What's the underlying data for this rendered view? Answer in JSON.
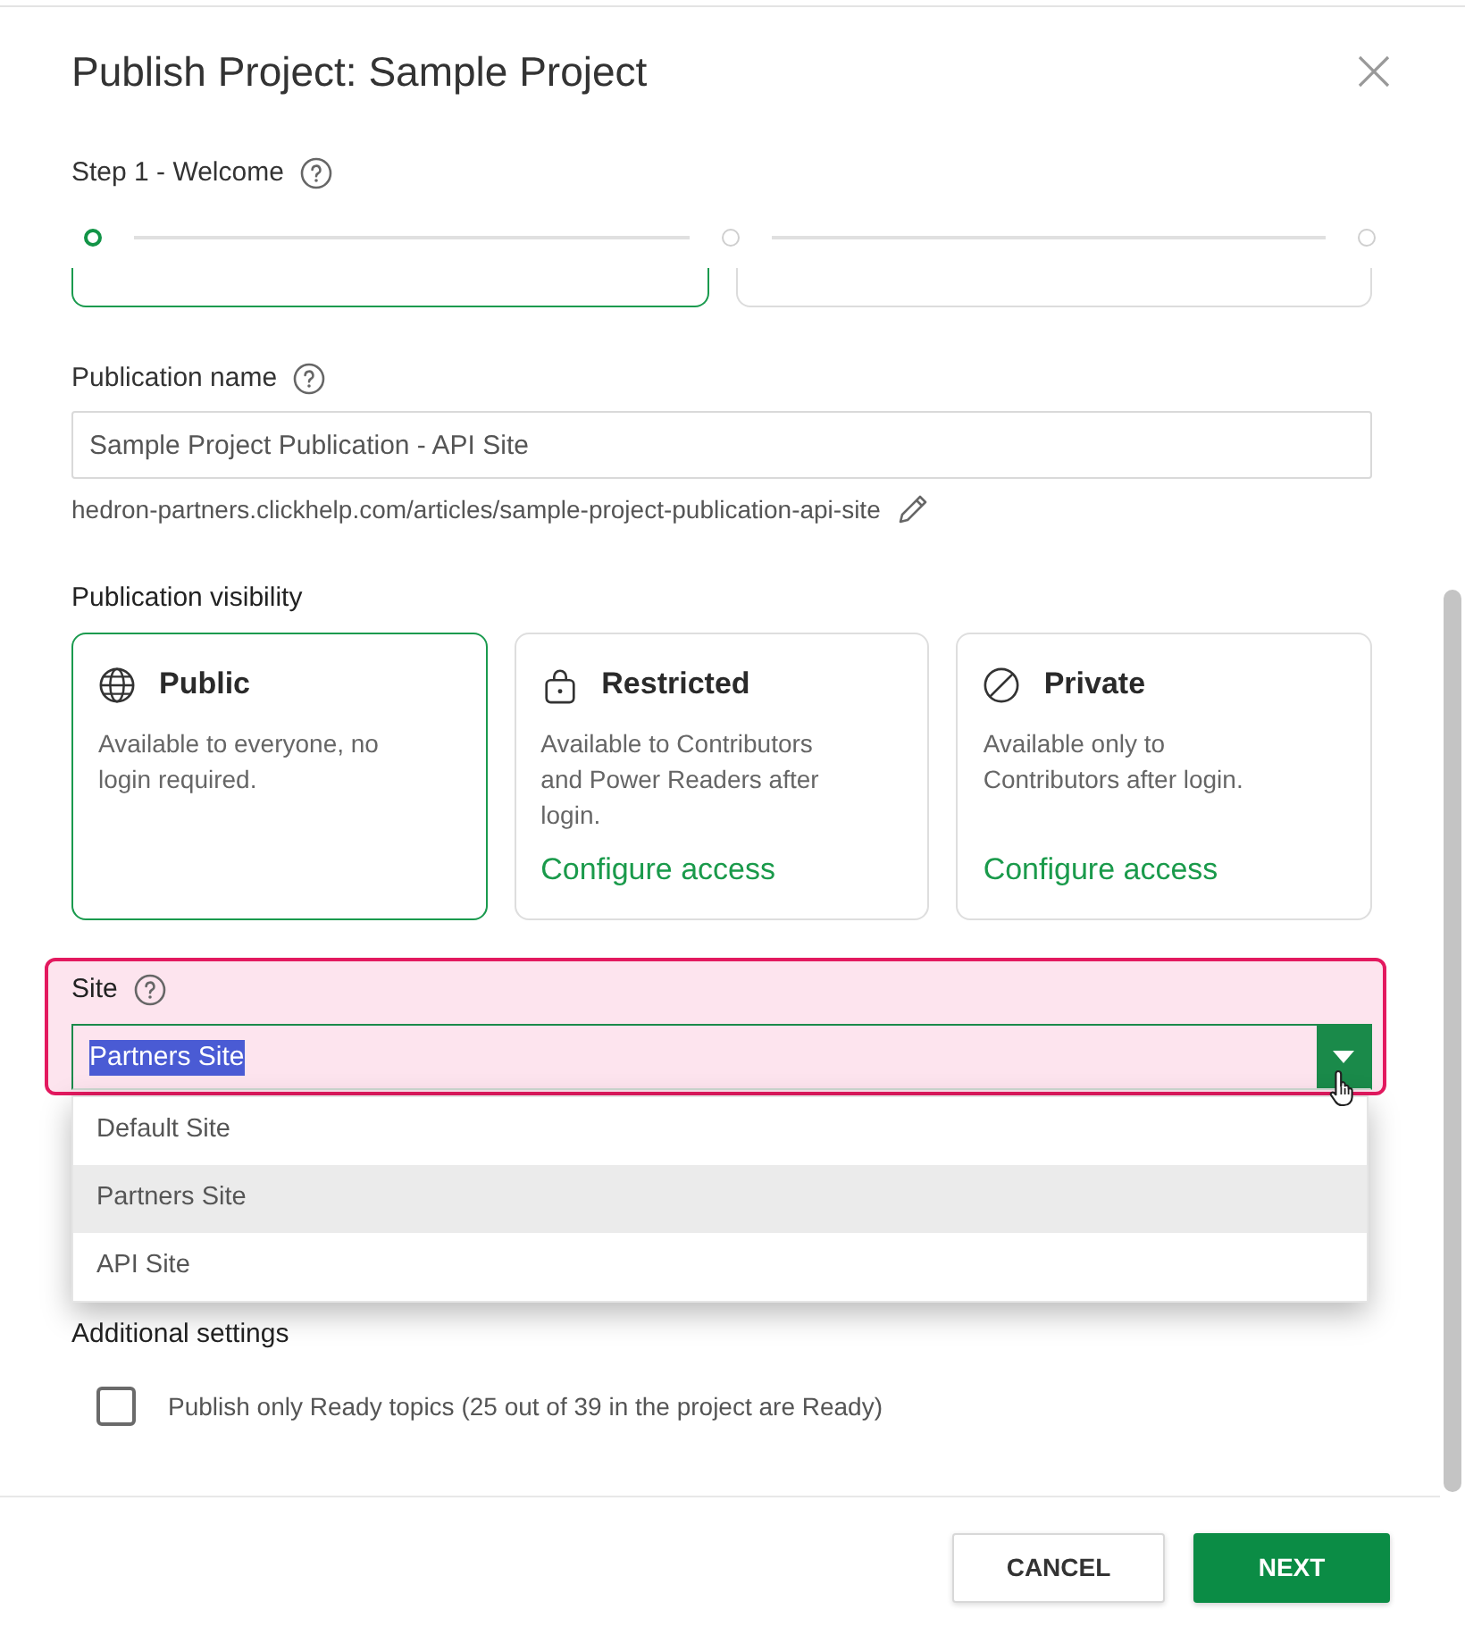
{
  "dialog": {
    "title": "Publish Project: Sample Project"
  },
  "step": {
    "label": "Step 1 - Welcome"
  },
  "stepper": [
    {
      "selected": true
    },
    {
      "selected": false
    },
    {
      "selected": false
    }
  ],
  "step_panels": [
    {
      "selected": true
    },
    {
      "selected": false
    }
  ],
  "publication_name": {
    "label": "Publication name",
    "value": "Sample Project Publication - API Site",
    "url": "hedron-partners.clickhelp.com/articles/sample-project-publication-api-site"
  },
  "visibility": {
    "label": "Publication visibility",
    "options": [
      {
        "kind": "globe",
        "title": "Public",
        "description": "Available to everyone, no login required.",
        "selected": true
      },
      {
        "kind": "lock",
        "title": "Restricted",
        "description": "Available to Contributors and Power Readers after login.",
        "link": "Configure access",
        "selected": false
      },
      {
        "kind": "ban",
        "title": "Private",
        "description": "Available only to Contributors after login.",
        "link": "Configure access",
        "selected": false
      }
    ]
  },
  "site": {
    "label": "Site",
    "value": "Partners Site",
    "highlighted": true,
    "text_selected": true,
    "expanded": true,
    "options": [
      {
        "label": "Default Site",
        "selected": false
      },
      {
        "label": "Partners Site",
        "selected": true
      },
      {
        "label": "API Site",
        "selected": false
      }
    ]
  },
  "additional_settings": {
    "label": "Additional settings",
    "checkbox": {
      "label": "Publish only Ready topics (25 out of 39 in the project are Ready)",
      "checked": false
    }
  },
  "buttons": [
    {
      "label": "CANCEL",
      "kind": "secondary"
    },
    {
      "label": "NEXT",
      "kind": "primary"
    }
  ]
}
